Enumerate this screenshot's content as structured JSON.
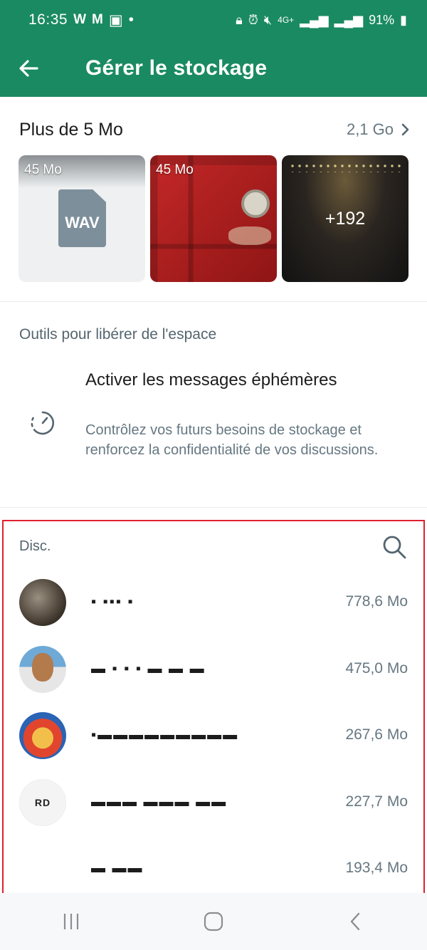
{
  "status_bar": {
    "time": "16:35",
    "left_icons": [
      "W",
      "M"
    ],
    "network": "4G+",
    "battery": "91%"
  },
  "app_bar": {
    "title": "Gérer le stockage"
  },
  "large_files": {
    "label": "Plus de 5 Mo",
    "total_size": "2,1 Go",
    "items": [
      {
        "size": "45 Mo",
        "file_ext": "WAV"
      },
      {
        "size": "45 Mo"
      },
      {
        "more_count": "+192"
      }
    ]
  },
  "tools": {
    "title": "Outils pour libérer de l'espace",
    "items": [
      {
        "name": "Activer les messages éphémères",
        "description": "Contrôlez vos futurs besoins de stockage et renforcez la confidentialité de vos discussions."
      }
    ]
  },
  "chats": {
    "title": "Disc.",
    "rows": [
      {
        "name": "▪ ▪▪▪ ▪",
        "size": "778,6 Mo"
      },
      {
        "name": "▬ ▪ ▪ ▪ ▬ ▬ ▬",
        "size": "475,0 Mo"
      },
      {
        "name": "▪▬▬▬▬▬▬▬▬▬",
        "size": "267,6 Mo"
      },
      {
        "name": "▬▬▬ ▬▬▬ ▬▬",
        "size": "227,7 Mo"
      },
      {
        "name": "▬ ▬▬",
        "size": "193,4 Mo"
      }
    ],
    "avatar_text_row4": "RD"
  },
  "colors": {
    "primary": "#1a8a62",
    "highlight_frame": "#e02030",
    "secondary_text": "#667781"
  }
}
